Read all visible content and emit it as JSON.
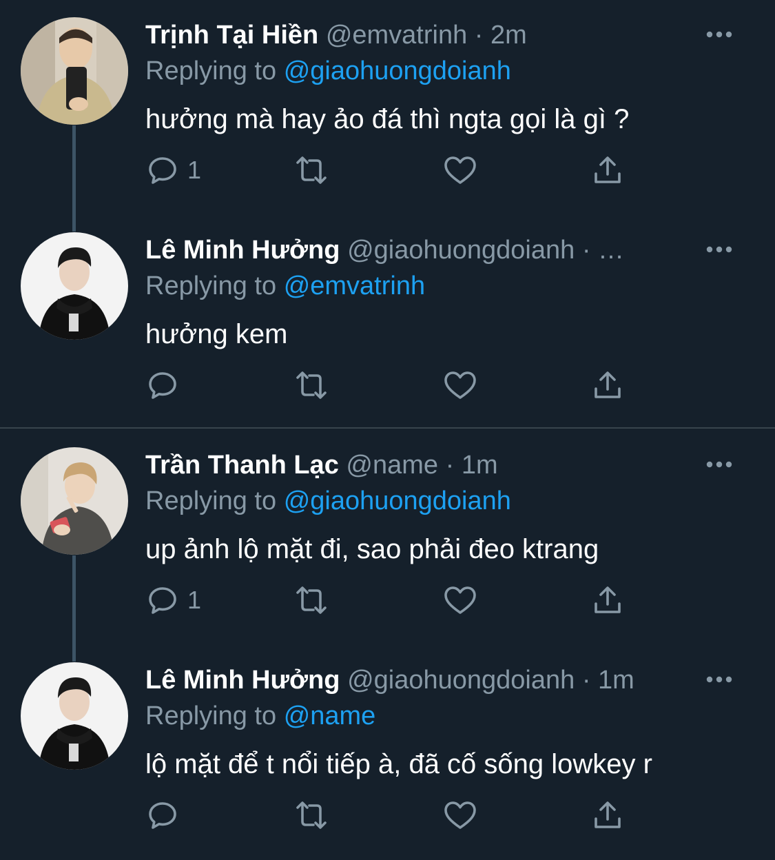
{
  "colors": {
    "background": "#15202b",
    "name": "#ffffff",
    "secondary": "#8899a6",
    "link": "#1da1f2",
    "thread_line": "#3d5466",
    "separator": "#38444d"
  },
  "tweets": [
    {
      "name": "Trịnh Tại Hiền",
      "handle": "@emvatrinh",
      "dot": "·",
      "time": "2m",
      "reply_prefix": "Replying to",
      "reply_handle": "@giaohuongdoianh",
      "text": "hưởng mà hay ảo đá thì ngta gọi là gì ?",
      "reply_count": "1",
      "icons": [
        "reply-icon",
        "retweet-icon",
        "like-icon",
        "share-icon",
        "more-icon"
      ]
    },
    {
      "name": "Lê Minh Hưởng",
      "handle": "@giaohuongdoianh",
      "dot": "·",
      "time": "…",
      "reply_prefix": "Replying to",
      "reply_handle": "@emvatrinh",
      "text": "hưởng kem",
      "reply_count": "",
      "icons": [
        "reply-icon",
        "retweet-icon",
        "like-icon",
        "share-icon",
        "more-icon"
      ]
    },
    {
      "name": "Trần Thanh Lạc",
      "handle": "@name",
      "dot": "·",
      "time": "1m",
      "reply_prefix": "Replying to",
      "reply_handle": "@giaohuongdoianh",
      "text": "up ảnh lộ mặt đi, sao phải đeo ktrang",
      "reply_count": "1",
      "icons": [
        "reply-icon",
        "retweet-icon",
        "like-icon",
        "share-icon",
        "more-icon"
      ]
    },
    {
      "name": "Lê Minh Hưởng",
      "handle": "@giaohuongdoianh",
      "dot": "·",
      "time": "1m",
      "reply_prefix": "Replying to",
      "reply_handle": "@name",
      "text": "lộ mặt để t nổi tiếp à, đã cố sống lowkey r",
      "reply_count": "",
      "icons": [
        "reply-icon",
        "retweet-icon",
        "like-icon",
        "share-icon",
        "more-icon"
      ]
    }
  ]
}
